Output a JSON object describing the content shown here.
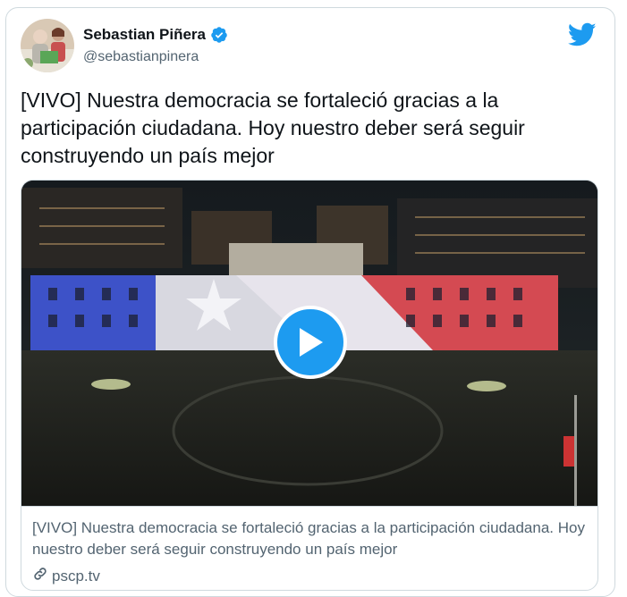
{
  "tweet": {
    "author_name": "Sebastian Piñera",
    "author_handle": "@sebastianpinera",
    "text": "[VIVO] Nuestra democracia se fortaleció gracias a la participación ciudadana. Hoy nuestro deber será seguir construyendo un país mejor",
    "verified": true
  },
  "card": {
    "description": "[VIVO] Nuestra democracia se fortaleció gracias a la participación ciudadana. Hoy nuestro deber será seguir construyendo un país mejor",
    "domain": "pscp.tv"
  },
  "icons": {
    "brand": "twitter-bird-icon",
    "verified": "verified-badge-icon",
    "play": "play-icon",
    "link": "link-icon"
  },
  "colors": {
    "brand_blue": "#1d9bf0",
    "text_primary": "#0f1419",
    "text_secondary": "#536471",
    "border": "#cfd9de"
  }
}
